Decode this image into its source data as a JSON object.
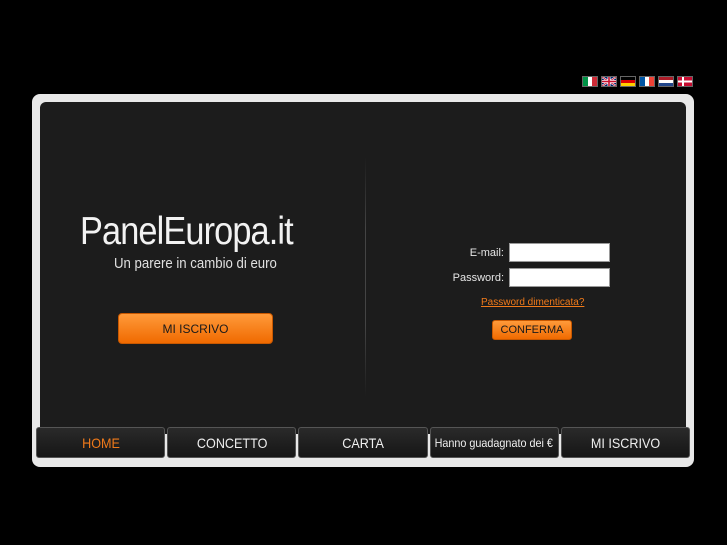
{
  "languages": [
    {
      "code": "it",
      "icon": "flag-italy-icon"
    },
    {
      "code": "en",
      "icon": "flag-uk-icon"
    },
    {
      "code": "de",
      "icon": "flag-germany-icon"
    },
    {
      "code": "fr",
      "icon": "flag-france-icon"
    },
    {
      "code": "nl",
      "icon": "flag-netherlands-icon"
    },
    {
      "code": "dk",
      "icon": "flag-denmark-icon"
    }
  ],
  "brand": {
    "name": "PanelEuropa.it",
    "tagline": "Un parere in cambio di euro"
  },
  "signup": {
    "label": "MI ISCRIVO"
  },
  "login": {
    "email_label": "E-mail:",
    "email_value": "",
    "password_label": "Password:",
    "password_value": "",
    "forgot_label": "Password dimenticata?",
    "submit_label": "CONFERMA"
  },
  "nav": {
    "items": [
      {
        "label": "HOME"
      },
      {
        "label": "CONCETTO"
      },
      {
        "label": "CARTA"
      },
      {
        "label": "Hanno guadagnato dei €"
      },
      {
        "label": "MI ISCRIVO"
      }
    ]
  },
  "colors": {
    "accent": "#f07a1a",
    "panel": "#1c1c1c",
    "frame": "#e8e8e8"
  }
}
